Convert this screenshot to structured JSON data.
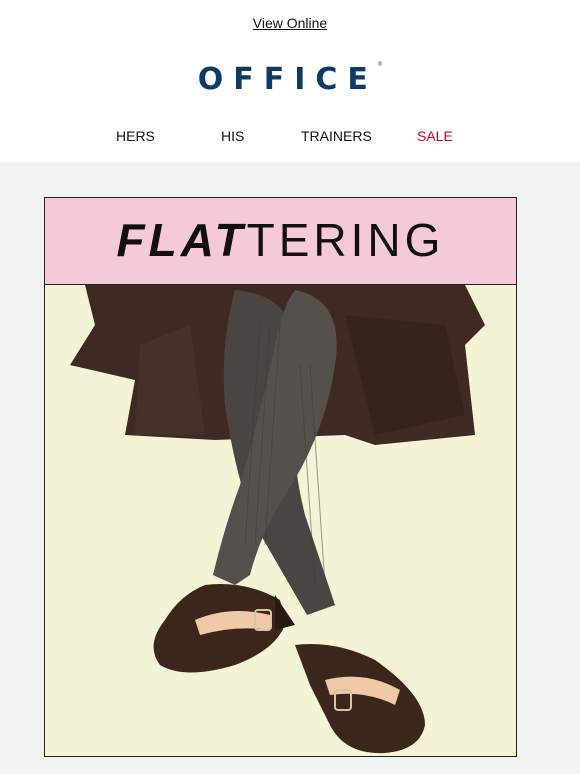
{
  "header": {
    "view_online": "View Online",
    "logo_text": "OFFICE",
    "logo_mark": "®"
  },
  "nav": {
    "items": [
      {
        "label": "HERS"
      },
      {
        "label": "HIS"
      },
      {
        "label": "TRAINERS"
      },
      {
        "label": "SALE"
      }
    ]
  },
  "hero": {
    "banner_bold": "FLAT",
    "banner_rest": "TERING"
  },
  "colors": {
    "brand_blue": "#0e3a66",
    "sale_red": "#d0021b",
    "banner_pink": "#f4c9d9",
    "photo_bg": "#f5f3d6",
    "page_grey": "#f1f3f2"
  }
}
